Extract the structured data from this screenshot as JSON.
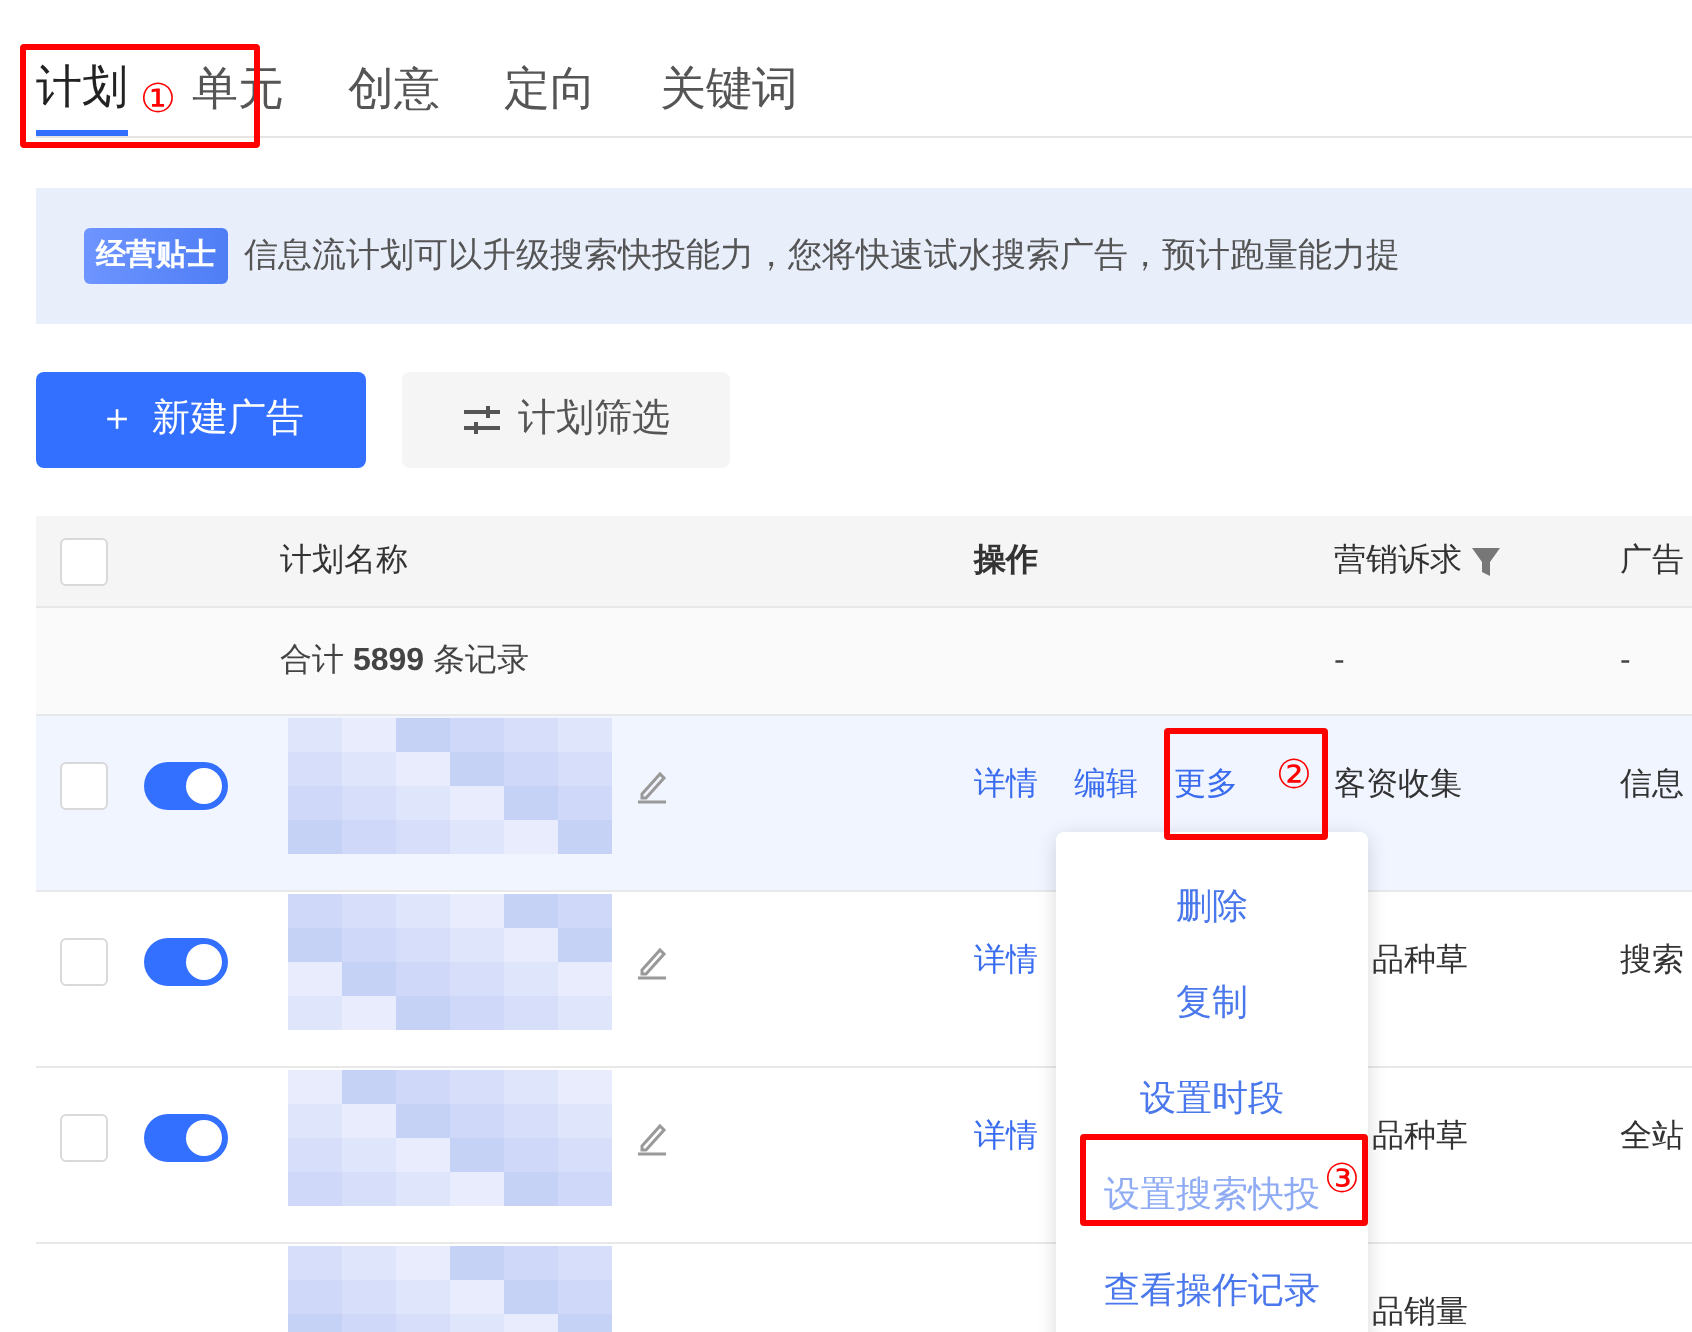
{
  "tabs": [
    {
      "label": "计划",
      "selected": true
    },
    {
      "label": "单元",
      "selected": false
    },
    {
      "label": "创意",
      "selected": false
    },
    {
      "label": "定向",
      "selected": false
    },
    {
      "label": "关键词",
      "selected": false
    }
  ],
  "tip": {
    "badge": "经营贴士",
    "text": "信息流计划可以升级搜索快投能力，您将快速试水搜索广告，预计跑量能力提"
  },
  "buttons": [
    {
      "label": "新建广告",
      "kind": "primary",
      "icon": "＋"
    },
    {
      "label": "计划筛选",
      "kind": "secondary"
    }
  ],
  "table": {
    "header_checked": false,
    "columns": [
      "计划名称",
      "操作",
      "营销诉求",
      "广告"
    ],
    "total": {
      "text": "合计 **5899** 条记录",
      "cells": [
        "-",
        "-"
      ]
    },
    "rows": [
      {
        "checked": false,
        "on": true,
        "hovered": true,
        "actions": [
          "详情",
          "编辑",
          "更多"
        ],
        "cells": [
          "客资收集",
          "信息"
        ]
      },
      {
        "checked": false,
        "on": true,
        "hovered": false,
        "actions": [
          "详情"
        ],
        "cells": [
          "品种草",
          "搜索"
        ]
      },
      {
        "checked": false,
        "on": true,
        "hovered": false,
        "actions": [
          "详情"
        ],
        "cells": [
          "品种草",
          "全站"
        ]
      },
      {
        "hovered": false,
        "actions": [],
        "cells": [
          "品销量",
          ""
        ]
      }
    ]
  },
  "dropdown": [
    {
      "label": "删除",
      "highlighted": false
    },
    {
      "label": "复制",
      "highlighted": false
    },
    {
      "label": "设置时段",
      "highlighted": false
    },
    {
      "label": "设置搜索快投",
      "highlighted": true
    },
    {
      "label": "查看操作记录",
      "highlighted": false
    }
  ],
  "annotations": [
    "①",
    "②",
    "③"
  ]
}
